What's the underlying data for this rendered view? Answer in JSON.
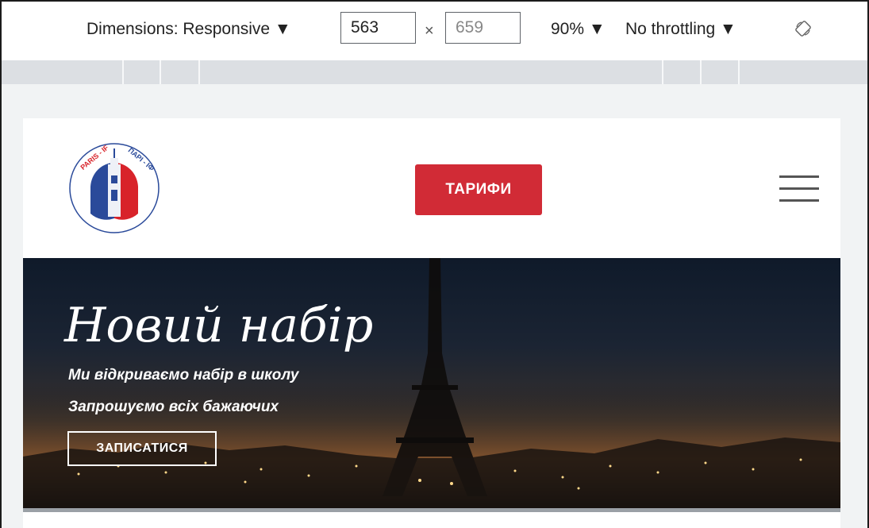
{
  "devtools": {
    "dimensions_label": "Dimensions: Responsive ▼",
    "width_value": "563",
    "times_symbol": "×",
    "height_placeholder": "659",
    "zoom_label": "90% ▼",
    "throttling_label": "No throttling ▼",
    "rotate_icon": "rotate-icon"
  },
  "site": {
    "logo_icon": "paris-if-logo",
    "tariff_button": "ТАРИФИ",
    "menu_icon": "hamburger-menu-icon",
    "hero": {
      "title": "Новий набір",
      "line1": "Ми відкриваємо набір в школу",
      "line2": "Запрошуємо всіх бажаючих",
      "signup_button": "ЗАПИСАТИСЯ"
    }
  },
  "colors": {
    "accent_red": "#d12b36",
    "logo_blue": "#2a4a9a",
    "logo_red": "#d8232a"
  }
}
